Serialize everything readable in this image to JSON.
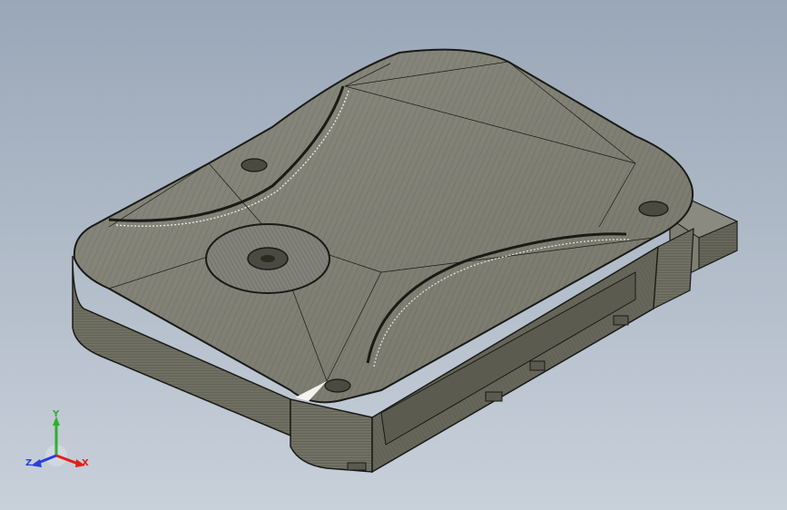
{
  "viewport": {
    "background_top": "#9aa7b8",
    "background_bottom": "#c8d0da"
  },
  "model": {
    "icon": "hard-drive-3d-mesh",
    "body_color": "#7d7d6b",
    "top_color": "#84847a",
    "edge_color": "#1a1a16"
  },
  "triad": {
    "x_label": "X",
    "y_label": "Y",
    "z_label": "Z",
    "x_color": "#e0201a",
    "y_color": "#2fae2f",
    "z_color": "#2b3fd8"
  }
}
